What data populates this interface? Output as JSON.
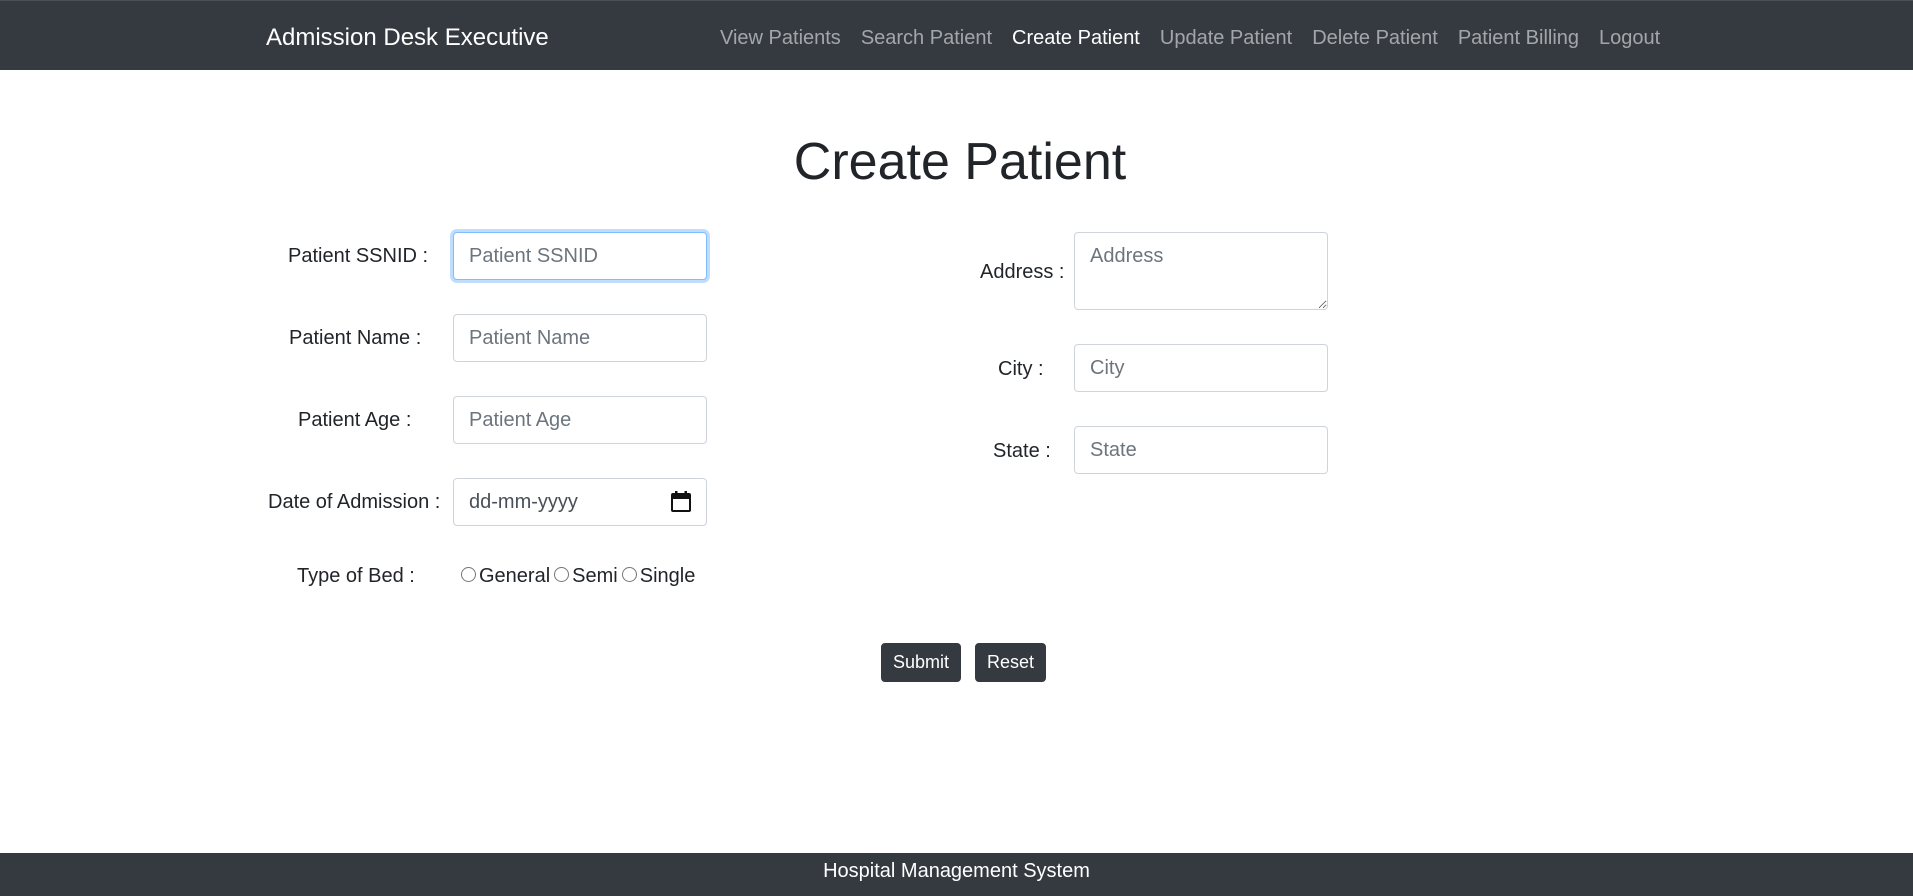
{
  "navbar": {
    "brand": "Admission Desk Executive",
    "links": [
      {
        "label": "View Patients",
        "active": false
      },
      {
        "label": "Search Patient",
        "active": false
      },
      {
        "label": "Create Patient",
        "active": true
      },
      {
        "label": "Update Patient",
        "active": false
      },
      {
        "label": "Delete Patient",
        "active": false
      },
      {
        "label": "Patient Billing",
        "active": false
      },
      {
        "label": "Logout",
        "active": false
      }
    ]
  },
  "page": {
    "title": "Create Patient"
  },
  "form": {
    "ssnid": {
      "label": "Patient SSNID :",
      "placeholder": "Patient SSNID",
      "value": ""
    },
    "name": {
      "label": "Patient Name :",
      "placeholder": "Patient Name",
      "value": ""
    },
    "age": {
      "label": "Patient Age :",
      "placeholder": "Patient Age",
      "value": ""
    },
    "admission_date": {
      "label": "Date of Admission :",
      "placeholder": "dd-mm-yyyy",
      "icon": "calendar-icon"
    },
    "bed_type": {
      "label": "Type of Bed :",
      "options": [
        "General",
        "Semi",
        "Single"
      ],
      "selected": ""
    },
    "address": {
      "label": "Address :",
      "placeholder": "Address",
      "value": ""
    },
    "city": {
      "label": "City :",
      "placeholder": "City",
      "value": ""
    },
    "state": {
      "label": "State :",
      "placeholder": "State",
      "value": ""
    },
    "submit_label": "Submit",
    "reset_label": "Reset"
  },
  "footer": {
    "text": "Hospital Management System"
  },
  "colors": {
    "navbar_bg": "#343a40",
    "button_bg": "#343a40",
    "focus_border": "#80bdff"
  }
}
